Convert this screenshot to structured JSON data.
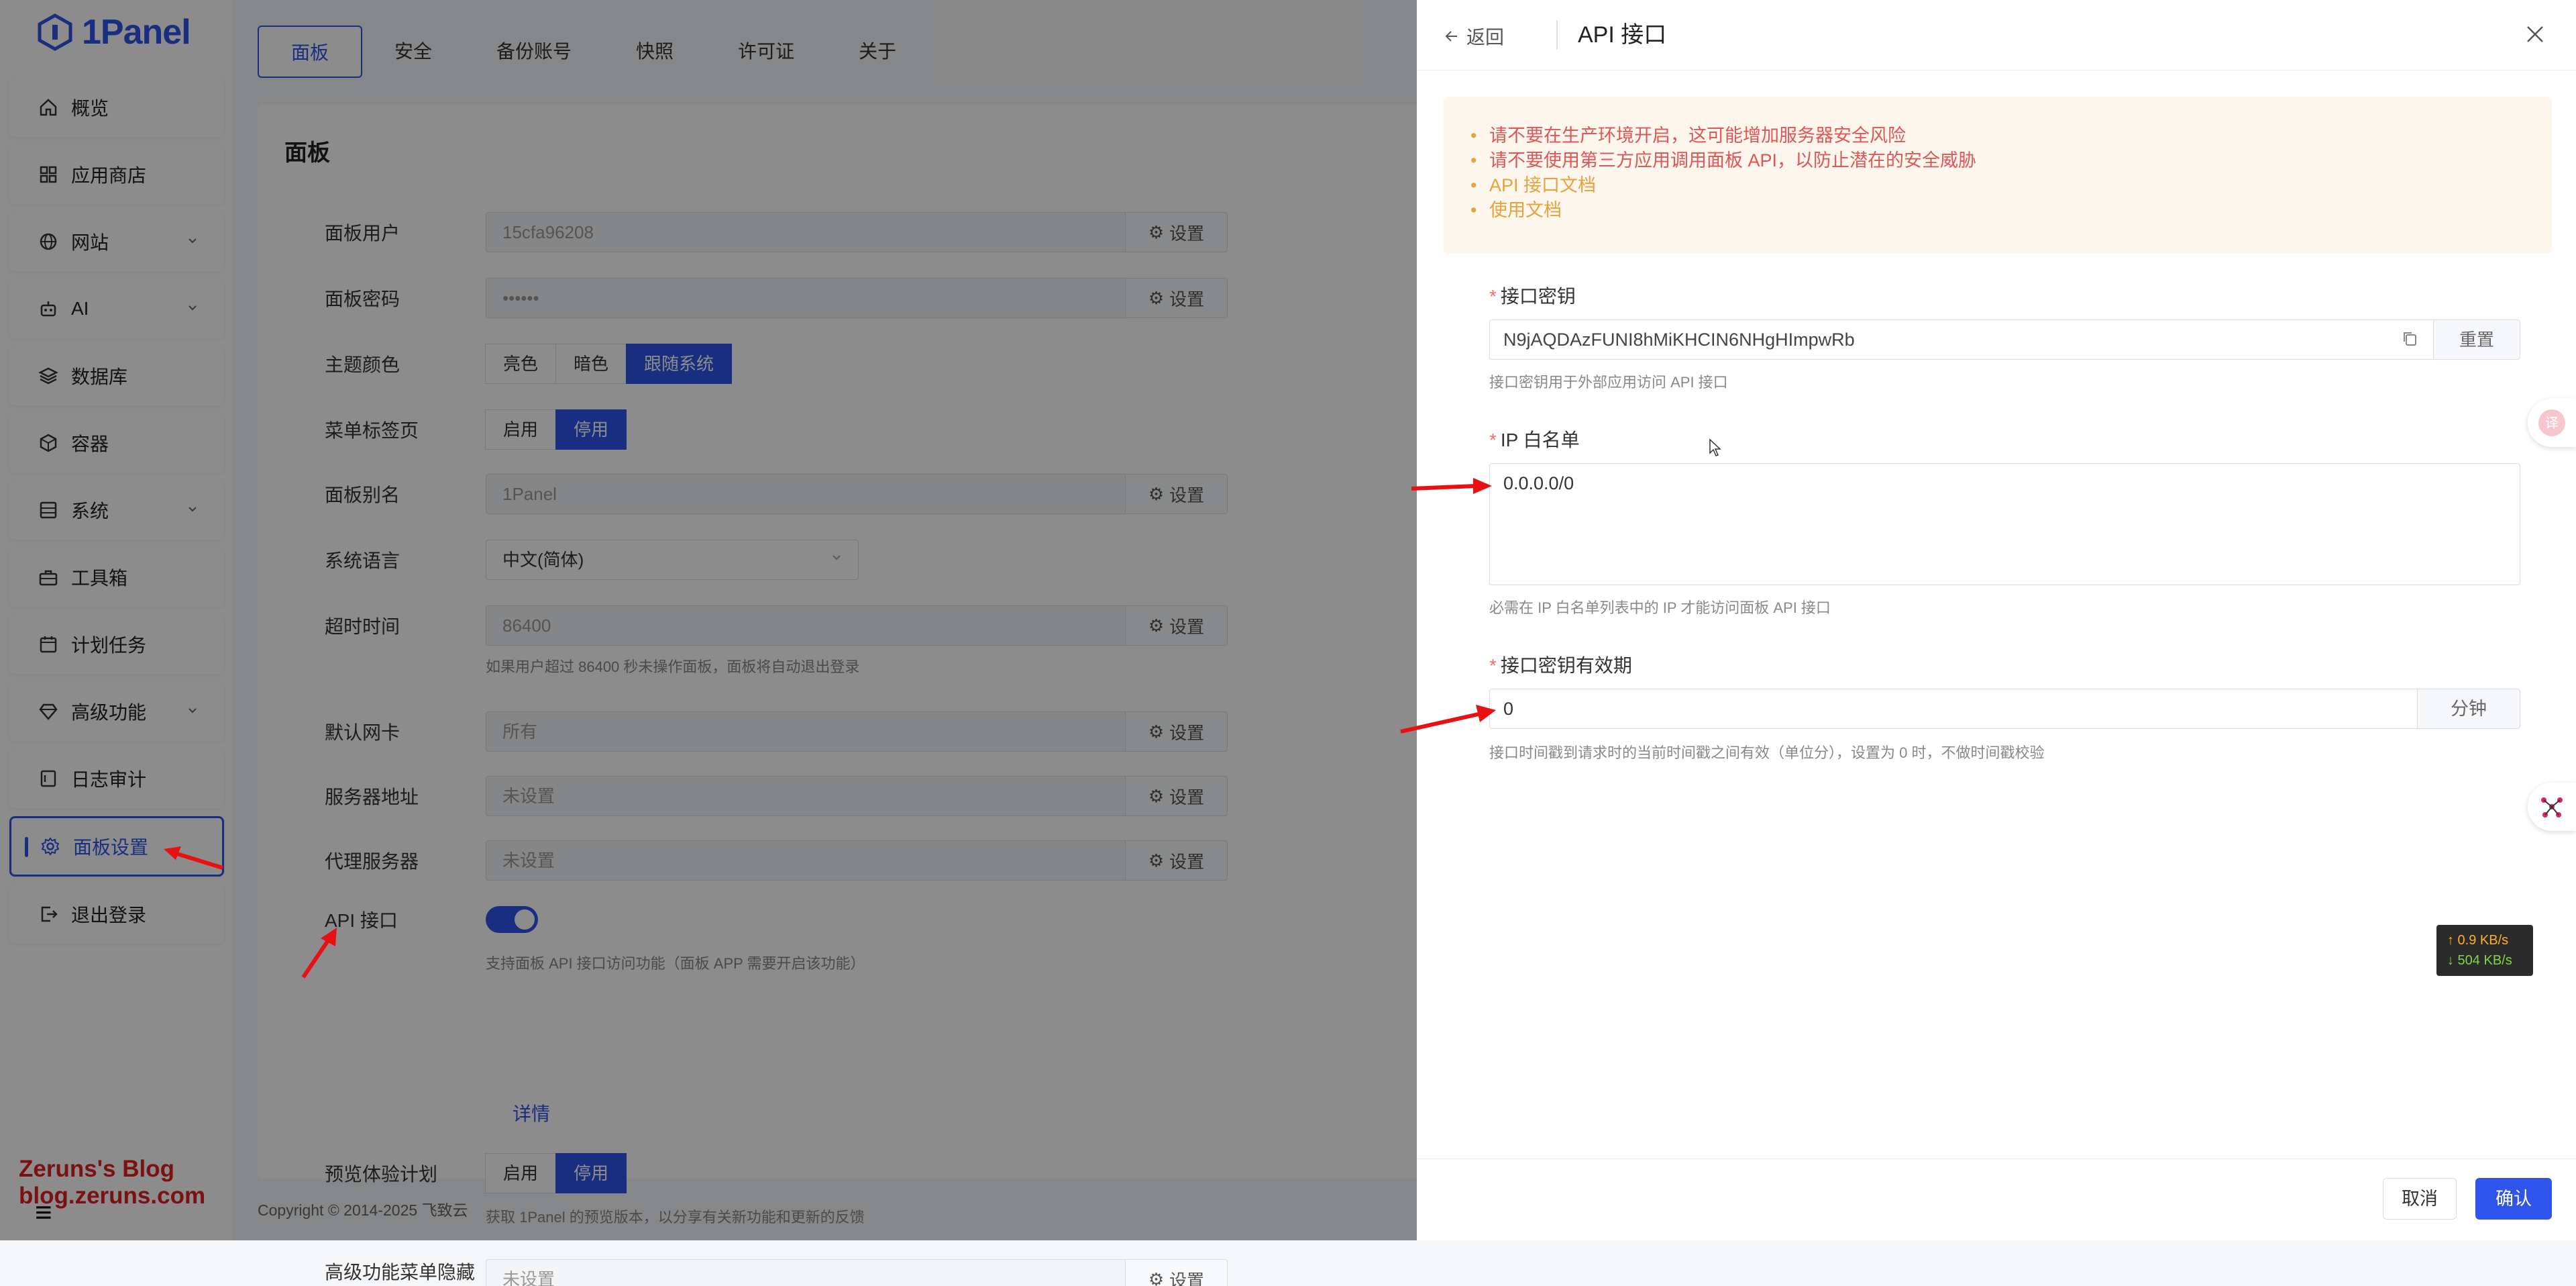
{
  "brand": {
    "name": "1Panel",
    "color": "#2f54eb"
  },
  "sidebar": {
    "items": [
      {
        "label": "概览",
        "icon": "home-icon"
      },
      {
        "label": "应用商店",
        "icon": "grid-icon"
      },
      {
        "label": "网站",
        "icon": "globe-icon",
        "expandable": true
      },
      {
        "label": "AI",
        "icon": "robot-icon",
        "expandable": true
      },
      {
        "label": "数据库",
        "icon": "layers-icon"
      },
      {
        "label": "容器",
        "icon": "cube-icon"
      },
      {
        "label": "系统",
        "icon": "server-icon",
        "expandable": true
      },
      {
        "label": "工具箱",
        "icon": "toolbox-icon"
      },
      {
        "label": "计划任务",
        "icon": "calendar-icon"
      },
      {
        "label": "高级功能",
        "icon": "diamond-icon",
        "expandable": true
      },
      {
        "label": "日志审计",
        "icon": "log-icon"
      },
      {
        "label": "面板设置",
        "icon": "gear-icon",
        "active": true
      },
      {
        "label": "退出登录",
        "icon": "logout-icon"
      }
    ]
  },
  "watermark": {
    "line1": "Zeruns's Blog",
    "line2": "blog.zeruns.com"
  },
  "tabs": [
    "面板",
    "安全",
    "备份账号",
    "快照",
    "许可证",
    "关于"
  ],
  "panel": {
    "title": "面板",
    "setting_label": "设置",
    "user": {
      "label": "面板用户",
      "value": "15cfa96208"
    },
    "password": {
      "label": "面板密码",
      "value": "••••••"
    },
    "theme": {
      "label": "主题颜色",
      "options": [
        "亮色",
        "暗色",
        "跟随系统"
      ],
      "selected": "跟随系统"
    },
    "menu_tabs": {
      "label": "菜单标签页",
      "options": [
        "启用",
        "停用"
      ],
      "selected": "停用"
    },
    "alias": {
      "label": "面板别名",
      "value": "1Panel"
    },
    "language": {
      "label": "系统语言",
      "value": "中文(简体)"
    },
    "timeout": {
      "label": "超时时间",
      "value": "86400",
      "help": "如果用户超过 86400 秒未操作面板，面板将自动退出登录"
    },
    "nic": {
      "label": "默认网卡",
      "value": "所有"
    },
    "server_addr": {
      "label": "服务器地址",
      "value": "未设置"
    },
    "proxy": {
      "label": "代理服务器",
      "value": "未设置"
    },
    "api": {
      "label": "API 接口",
      "enabled": true,
      "help": "支持面板 API 接口访问功能（面板 APP 需要开启该功能）",
      "detail_link": "详情"
    },
    "preview": {
      "label": "预览体验计划",
      "options": [
        "启用",
        "停用"
      ],
      "selected": "停用",
      "help": "获取 1Panel 的预览版本，以分享有关新功能和更新的反馈"
    },
    "hide_menu": {
      "label": "高级功能菜单隐藏",
      "value": "未设置"
    }
  },
  "copyright": "Copyright © 2014-2025 飞致云",
  "drawer": {
    "back_label": "返回",
    "title": "API 接口",
    "alert": [
      {
        "text": "请不要在生产环境开启，这可能增加服务器安全风险",
        "tone": "red"
      },
      {
        "text": "请不要使用第三方应用调用面板 API，以防止潜在的安全威胁",
        "tone": "red"
      },
      {
        "text": "API 接口文档",
        "tone": "orange"
      },
      {
        "text": "使用文档",
        "tone": "orange"
      }
    ],
    "key": {
      "label": "接口密钥",
      "value": "N9jAQDAzFUNI8hMiKHCIN6NHgHImpwRb",
      "reset_label": "重置",
      "help": "接口密钥用于外部应用访问 API 接口"
    },
    "whitelist": {
      "label": "IP 白名单",
      "value": "0.0.0.0/0",
      "help": "必需在 IP 白名单列表中的 IP 才能访问面板 API 接口"
    },
    "validity": {
      "label": "接口密钥有效期",
      "value": "0",
      "unit": "分钟",
      "help": "接口时间戳到请求时的当前时间戳之间有效（单位分），设置为 0 时，不做时间戳校验"
    },
    "cancel_label": "取消",
    "confirm_label": "确认"
  },
  "network": {
    "up": "↑ 0.9 KB/s",
    "down": "↓ 504 KB/s"
  },
  "colors": {
    "accent": "#2f54eb",
    "annotation_arrow": "#e81010",
    "alert_bg": "#fdf6ec"
  }
}
